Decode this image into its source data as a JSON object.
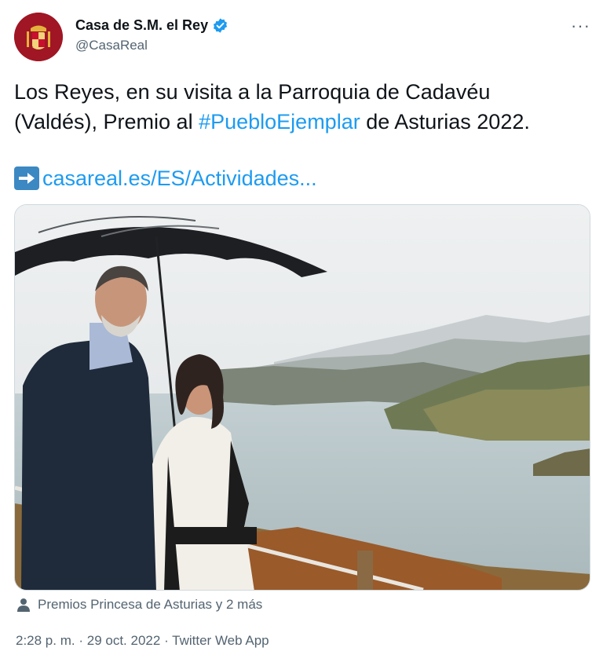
{
  "author": {
    "display_name": "Casa de S.M. el Rey",
    "handle": "@CasaReal",
    "verified": true,
    "avatar_icon": "royal-coat-of-arms-icon"
  },
  "more_label": "···",
  "tweet": {
    "line1": "Los Reyes, en su visita a la Parroquia de Cadavéu",
    "line2_before": "(Valdés), Premio al ",
    "hashtag": "#PuebloEjemplar",
    "line2_after": " de Asturias 2022.",
    "link_icon": "right-arrow-emoji-icon",
    "link_text": "casareal.es/ES/Actividades..."
  },
  "media": {
    "description_icon": "photo"
  },
  "tagged": {
    "icon": "person-icon",
    "text": "Premios Princesa de Asturias y 2 más"
  },
  "meta": {
    "time": "2:28 p. m.",
    "separator": "·",
    "date": "29 oct. 2022",
    "source": "Twitter Web App"
  },
  "colors": {
    "link": "#1d9bf0",
    "secondary_text": "#536471",
    "avatar_bg": "#a01624",
    "verified_badge": "#1d9bf0"
  }
}
